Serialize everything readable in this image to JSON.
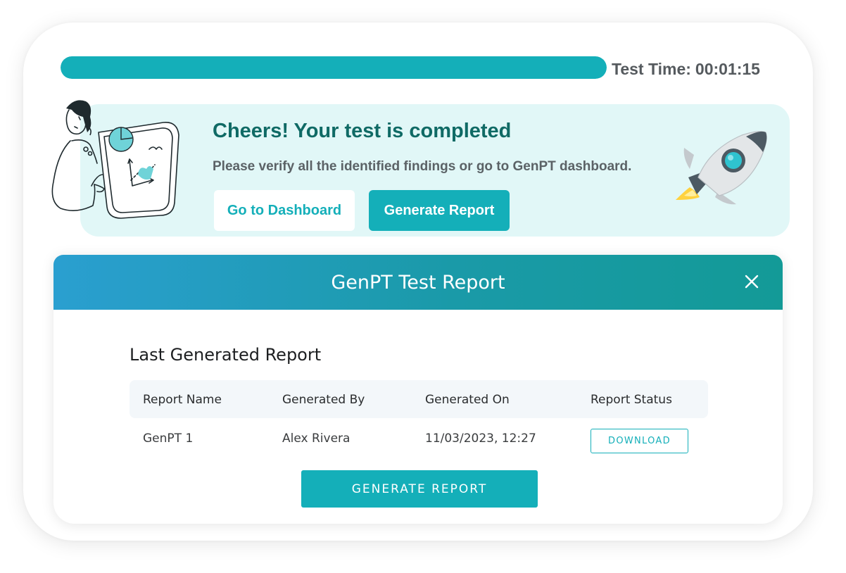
{
  "progress": {
    "value_percent": 100,
    "color": "#14afb9"
  },
  "test_time": {
    "label": "Test Time:",
    "value": "00:01:15"
  },
  "banner": {
    "title": "Cheers! Your test is completed",
    "subtitle": "Please verify all the identified findings or go to GenPT dashboard.",
    "dashboard_button": "Go to Dashboard",
    "generate_button": "Generate Report",
    "illustrations": [
      "woman-presenting-chart-illustration",
      "rocket-illustration"
    ]
  },
  "modal": {
    "title": "GenPT Test Report",
    "close_icon": "close-icon",
    "section_title": "Last Generated Report",
    "table": {
      "headers": [
        "Report Name",
        "Generated By",
        "Generated On",
        "Report Status"
      ],
      "rows": [
        {
          "name": "GenPT 1",
          "by": "Alex Rivera",
          "on": "11/03/2023, 12:27",
          "status_action": "DOWNLOAD"
        }
      ]
    },
    "generate_button": "GENERATE REPORT"
  },
  "colors": {
    "accent": "#14afb9",
    "banner_bg": "#e1f7f7",
    "title_green": "#0f6a65",
    "header_gradient_start": "#2a9fd0",
    "header_gradient_end": "#139a97"
  }
}
